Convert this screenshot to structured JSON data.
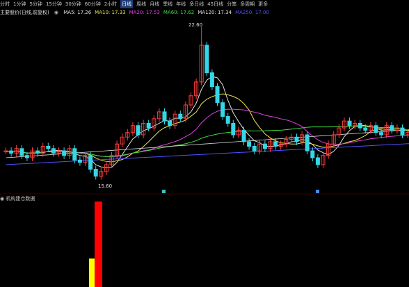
{
  "toolbar": {
    "items": [
      "分时",
      "1分钟",
      "5分钟",
      "15分钟",
      "30分钟",
      "60分钟",
      "2小时",
      "日线",
      "周线",
      "月线",
      "季线",
      "年线",
      "多日线",
      "45日线",
      "分笔",
      "多周期",
      "更多"
    ],
    "active_index": 7
  },
  "indicator": {
    "title": "主要股价(日线,前复权)",
    "ma": [
      {
        "label": "MA5: 17.26",
        "color": "#e0e0e0"
      },
      {
        "label": "MA10: 17.33",
        "color": "#e8e84c"
      },
      {
        "label": "MA20: 17.53",
        "color": "#e040e0"
      },
      {
        "label": "MA60: 17.62",
        "color": "#3ce03c"
      },
      {
        "label": "MA120: 17.34",
        "color": "#e0e0e0"
      },
      {
        "label": "MA250: 17.00",
        "color": "#5050ff"
      }
    ]
  },
  "price_labels": {
    "high": "22.60",
    "low": "15.60"
  },
  "subpanel": {
    "title": "机构建仓数据"
  },
  "colors": {
    "up": "#ff3c3c",
    "down": "#36d6e6",
    "bg": "#000000",
    "volume_red": "#ff0000",
    "volume_yellow": "#ffff00"
  }
}
